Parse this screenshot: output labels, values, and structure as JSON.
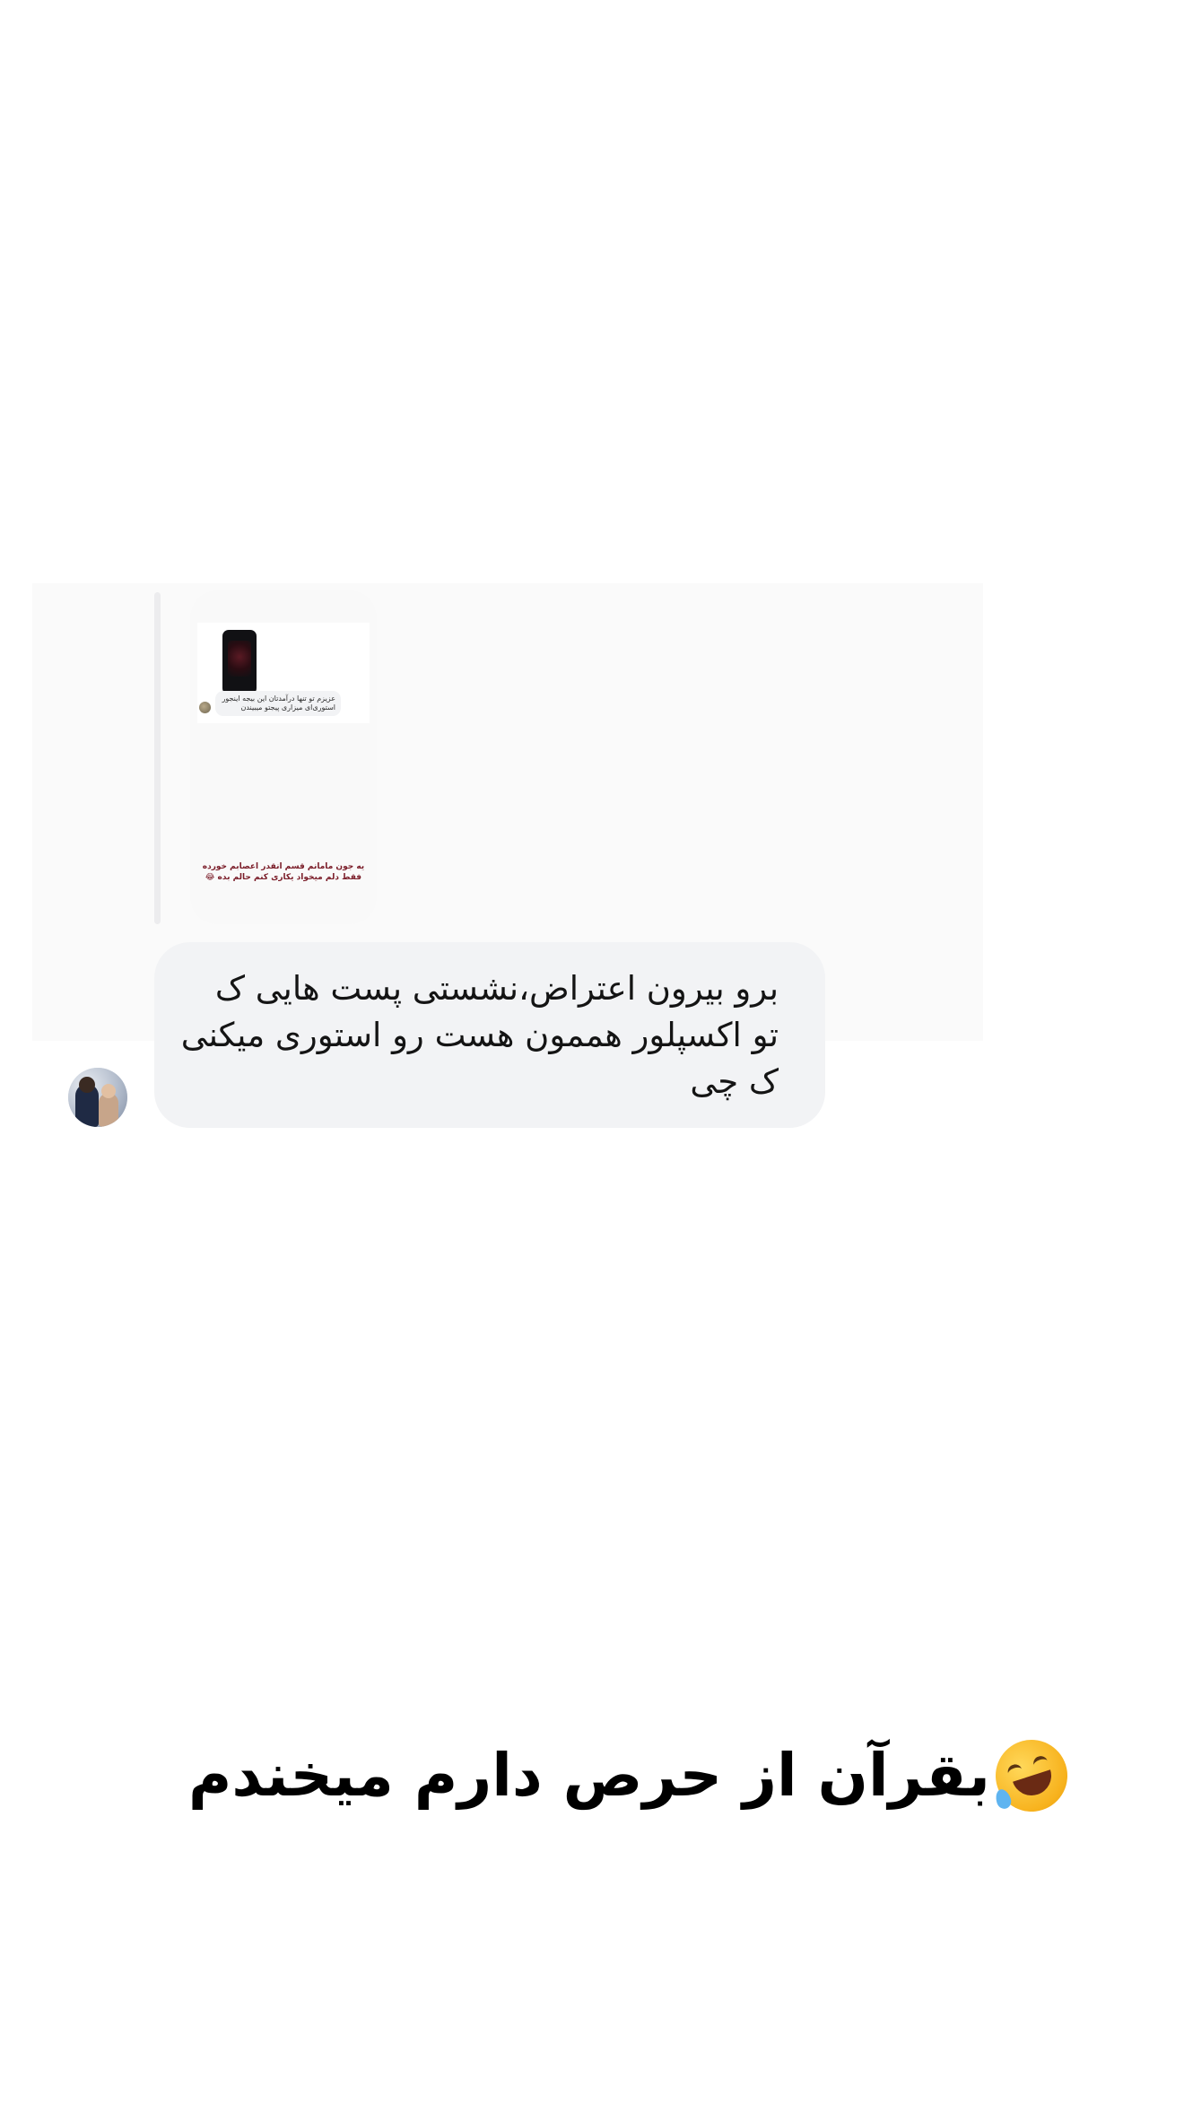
{
  "reply": {
    "story_comment": "عزیزم تو تنها درآمدتان این بیجه اینجور استوری‌ای میزاری پیجتو میبیندن",
    "story_caption": "یه جون مامانم قسم انقدر اعصابم خورده فقط دلم میخواد یکاری کنم حالم بده 😂"
  },
  "message": {
    "text": "برو بیرون اعتراض،نشستی پست هایی ک تو اکسپلور هممون هست رو استوری میکنی ک چی"
  },
  "caption": {
    "text": "بقرآن از حرص دارم میخندم",
    "emoji": "rolling-on-floor-laughing-icon"
  }
}
